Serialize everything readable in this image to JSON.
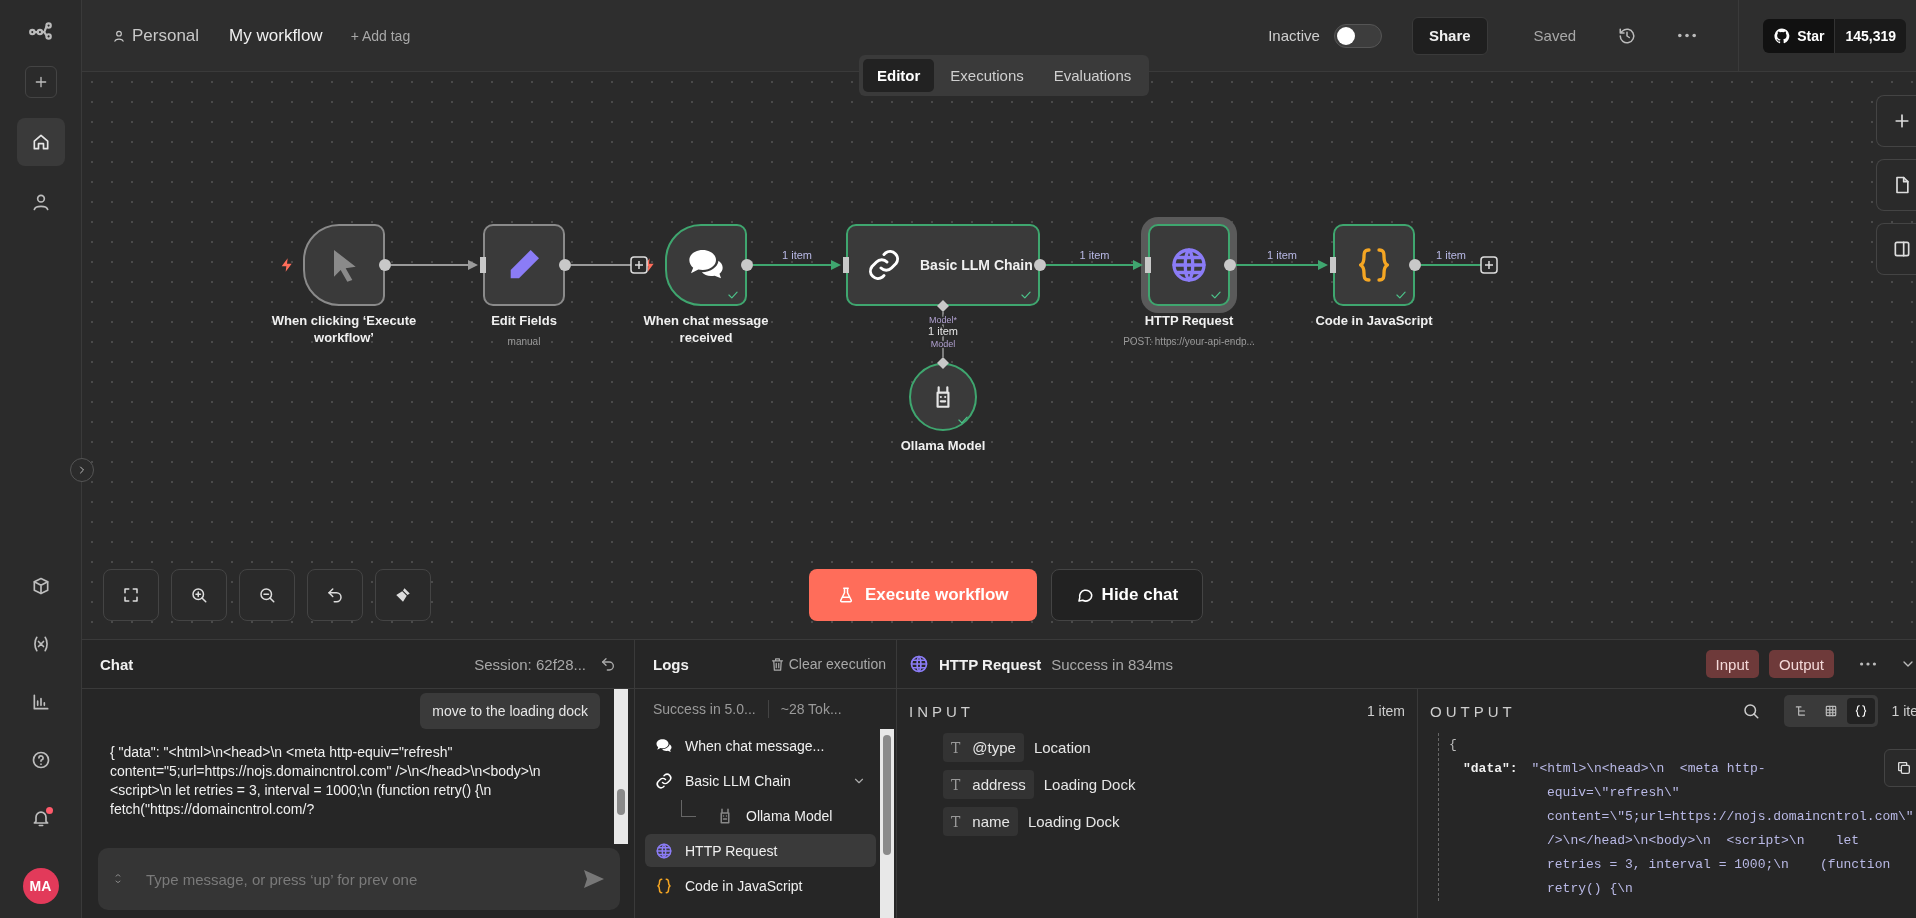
{
  "sidebar": {
    "top_items": [
      {
        "selected": false
      },
      {
        "selected": true
      },
      {
        "selected": false
      }
    ],
    "bell_unread": true,
    "avatar": "MA"
  },
  "top_bar": {
    "project": "Personal",
    "workflow_name": "My workflow",
    "add_tag": "+ Add tag",
    "status_label": "Inactive",
    "active": false,
    "share": "Share",
    "save_state": "Saved",
    "star_label": "Star",
    "star_count": "145,319"
  },
  "tabs": [
    {
      "label": "Editor",
      "selected": true
    },
    {
      "label": "Executions",
      "selected": false
    },
    {
      "label": "Evaluations",
      "selected": false
    }
  ],
  "canvas": {
    "nodes": [
      {
        "name": "When clicking ‘Execute workflow’",
        "kind": "trigger",
        "success": false,
        "selected": false
      },
      {
        "name": "Edit Fields",
        "subtitle": "manual",
        "kind": "action",
        "success": false,
        "selected": false
      },
      {
        "name": "When chat message received",
        "kind": "trigger",
        "success": true,
        "selected": false
      },
      {
        "name": "Basic LLM Chain",
        "kind": "wide",
        "success": true,
        "selected": false
      },
      {
        "name": "HTTP Request",
        "subtitle": "POST: https://your-api-endp...",
        "kind": "action",
        "success": true,
        "selected": true
      },
      {
        "name": "Code in JavaScript",
        "kind": "action",
        "success": true,
        "selected": false
      },
      {
        "name": "Ollama Model",
        "kind": "sub",
        "success": true,
        "selected": false
      }
    ],
    "edges": [
      {
        "kind": "main"
      },
      {
        "kind": "open"
      },
      {
        "kind": "main",
        "label": "1 item"
      },
      {
        "kind": "main",
        "label": "1 item"
      },
      {
        "kind": "main",
        "label": "1 item"
      },
      {
        "kind": "open",
        "label": "1 item"
      },
      {
        "kind": "sub",
        "labels": [
          "Model*",
          "1 item",
          "Model"
        ]
      }
    ],
    "execute_button": "Execute workflow",
    "hide_chat_button": "Hide chat"
  },
  "chat": {
    "title": "Chat",
    "session": "Session: 62f28...",
    "messages": [
      {
        "kind": "user",
        "text": "move to the loading dock"
      },
      {
        "kind": "bot",
        "text": "{ \"data\": \"<html>\\n<head>\\n <meta http-equiv=\"refresh\" content=\"5;url=https://nojs.domaincntrol.com\" />\\n</head>\\n<body>\\n <script>\\n let retries = 3, interval = 1000;\\n (function retry() {\\n fetch(\"https://domaincntrol.com/?"
      }
    ],
    "placeholder": "Type message, or press ‘up’ for prev one"
  },
  "logs": {
    "title": "Logs",
    "clear": "Clear execution",
    "summary": [
      "Success in 5.0...",
      "~28 Tok..."
    ],
    "items": [
      {
        "label": "When chat message...",
        "selected": false
      },
      {
        "label": "Basic LLM Chain",
        "selected": false,
        "expanded": true,
        "children": [
          {
            "label": "Ollama Model",
            "selected": false
          }
        ]
      },
      {
        "label": "HTTP Request",
        "selected": true
      },
      {
        "label": "Code in JavaScript",
        "selected": false
      }
    ]
  },
  "node_panel": {
    "title": "HTTP Request",
    "status": "Success in 834ms",
    "mode_buttons": [
      "Input",
      "Output"
    ],
    "input": {
      "heading": "INPUT",
      "count": "1 item",
      "fields": [
        {
          "type": "T",
          "key": "@type",
          "value": "Location"
        },
        {
          "type": "T",
          "key": "address",
          "value": "Loading Dock"
        },
        {
          "type": "T",
          "key": "name",
          "value": "Loading Dock"
        }
      ]
    },
    "output": {
      "heading": "OUTPUT",
      "count": "1 ite",
      "views": [
        {
          "selected": false
        },
        {
          "selected": false
        },
        {
          "selected": true
        }
      ],
      "open_brace": "{",
      "key": "\"data\":",
      "value_lines": [
        "\"<html>\\n<head>\\n  <meta http-",
        "equiv=\\\"refresh\\\"",
        "content=\\\"5;url=https://nojs.domaincntrol.com\\\"",
        "/>\\n</head>\\n<body>\\n  <script>\\n    let",
        "retries = 3, interval = 1000;\\n    (function",
        "retry() {\\n"
      ]
    }
  }
}
